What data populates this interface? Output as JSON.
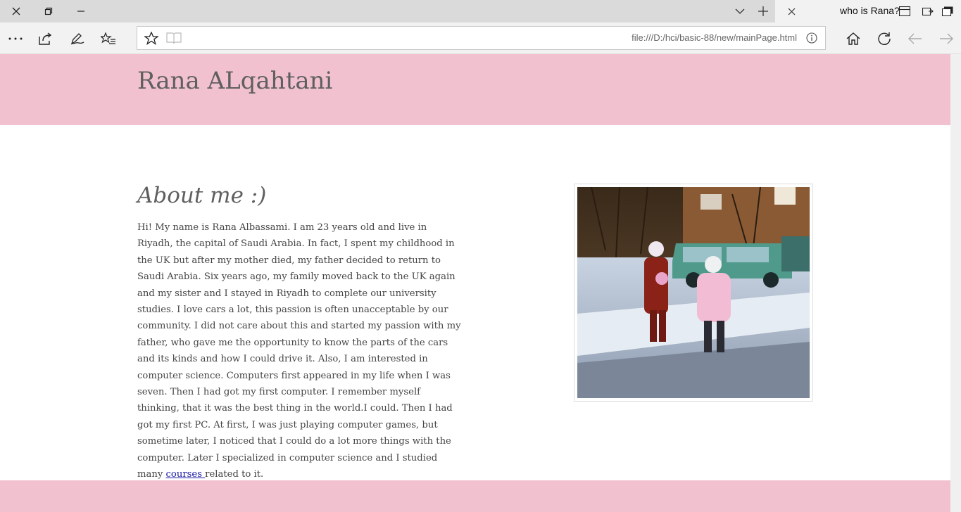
{
  "browser": {
    "tab_title": "who is Rana?",
    "url": "file:///D:/hci/basic-88/new/mainPage.html"
  },
  "page": {
    "site_title": "Rana ALqahtani",
    "about_heading": "About me :)",
    "about_text_before_link": "Hi! My name is Rana Albassami. I am 23 years old and live in Riyadh, the capital of Saudi Arabia. In fact, I spent my childhood in the UK but after my mother died, my father decided to return to Saudi Arabia. Six years ago, my family moved back to the UK again and my sister and I stayed in Riyadh to complete our university studies. I love cars a lot, this passion is often unacceptable by our community. I did not care about this and started my passion with my father, who gave me the opportunity to know the parts of the cars and its kinds and how I could drive it. Also, I am interested in computer science. Computers first appeared in my life when I was seven. Then I had got my first computer. I remember myself thinking, that it was the best thing in the world.I could. Then I had got my first PC. At first, I was just playing computer games, but sometime later, I noticed that I could do a lot more things with the computer. Later I specialized in computer science and I studied many ",
    "about_link_text": "courses ",
    "about_text_after_link": "related to it."
  },
  "colors": {
    "header_bg": "#f2c1cf",
    "link": "#1a1aa6"
  },
  "icons": {
    "titlebar": [
      "close-window-icon",
      "restore-icon",
      "minimize-icon",
      "tab-list-icon",
      "new-tab-icon",
      "close-tab-icon",
      "tab-preview-icon",
      "set-aside-icon",
      "tabs-aside-icon"
    ],
    "toolbar": [
      "more-icon",
      "share-icon",
      "notes-icon",
      "favorites-hub-icon",
      "favorite-star-icon",
      "reading-view-icon",
      "site-info-icon",
      "home-icon",
      "refresh-icon",
      "back-icon",
      "forward-icon"
    ]
  }
}
